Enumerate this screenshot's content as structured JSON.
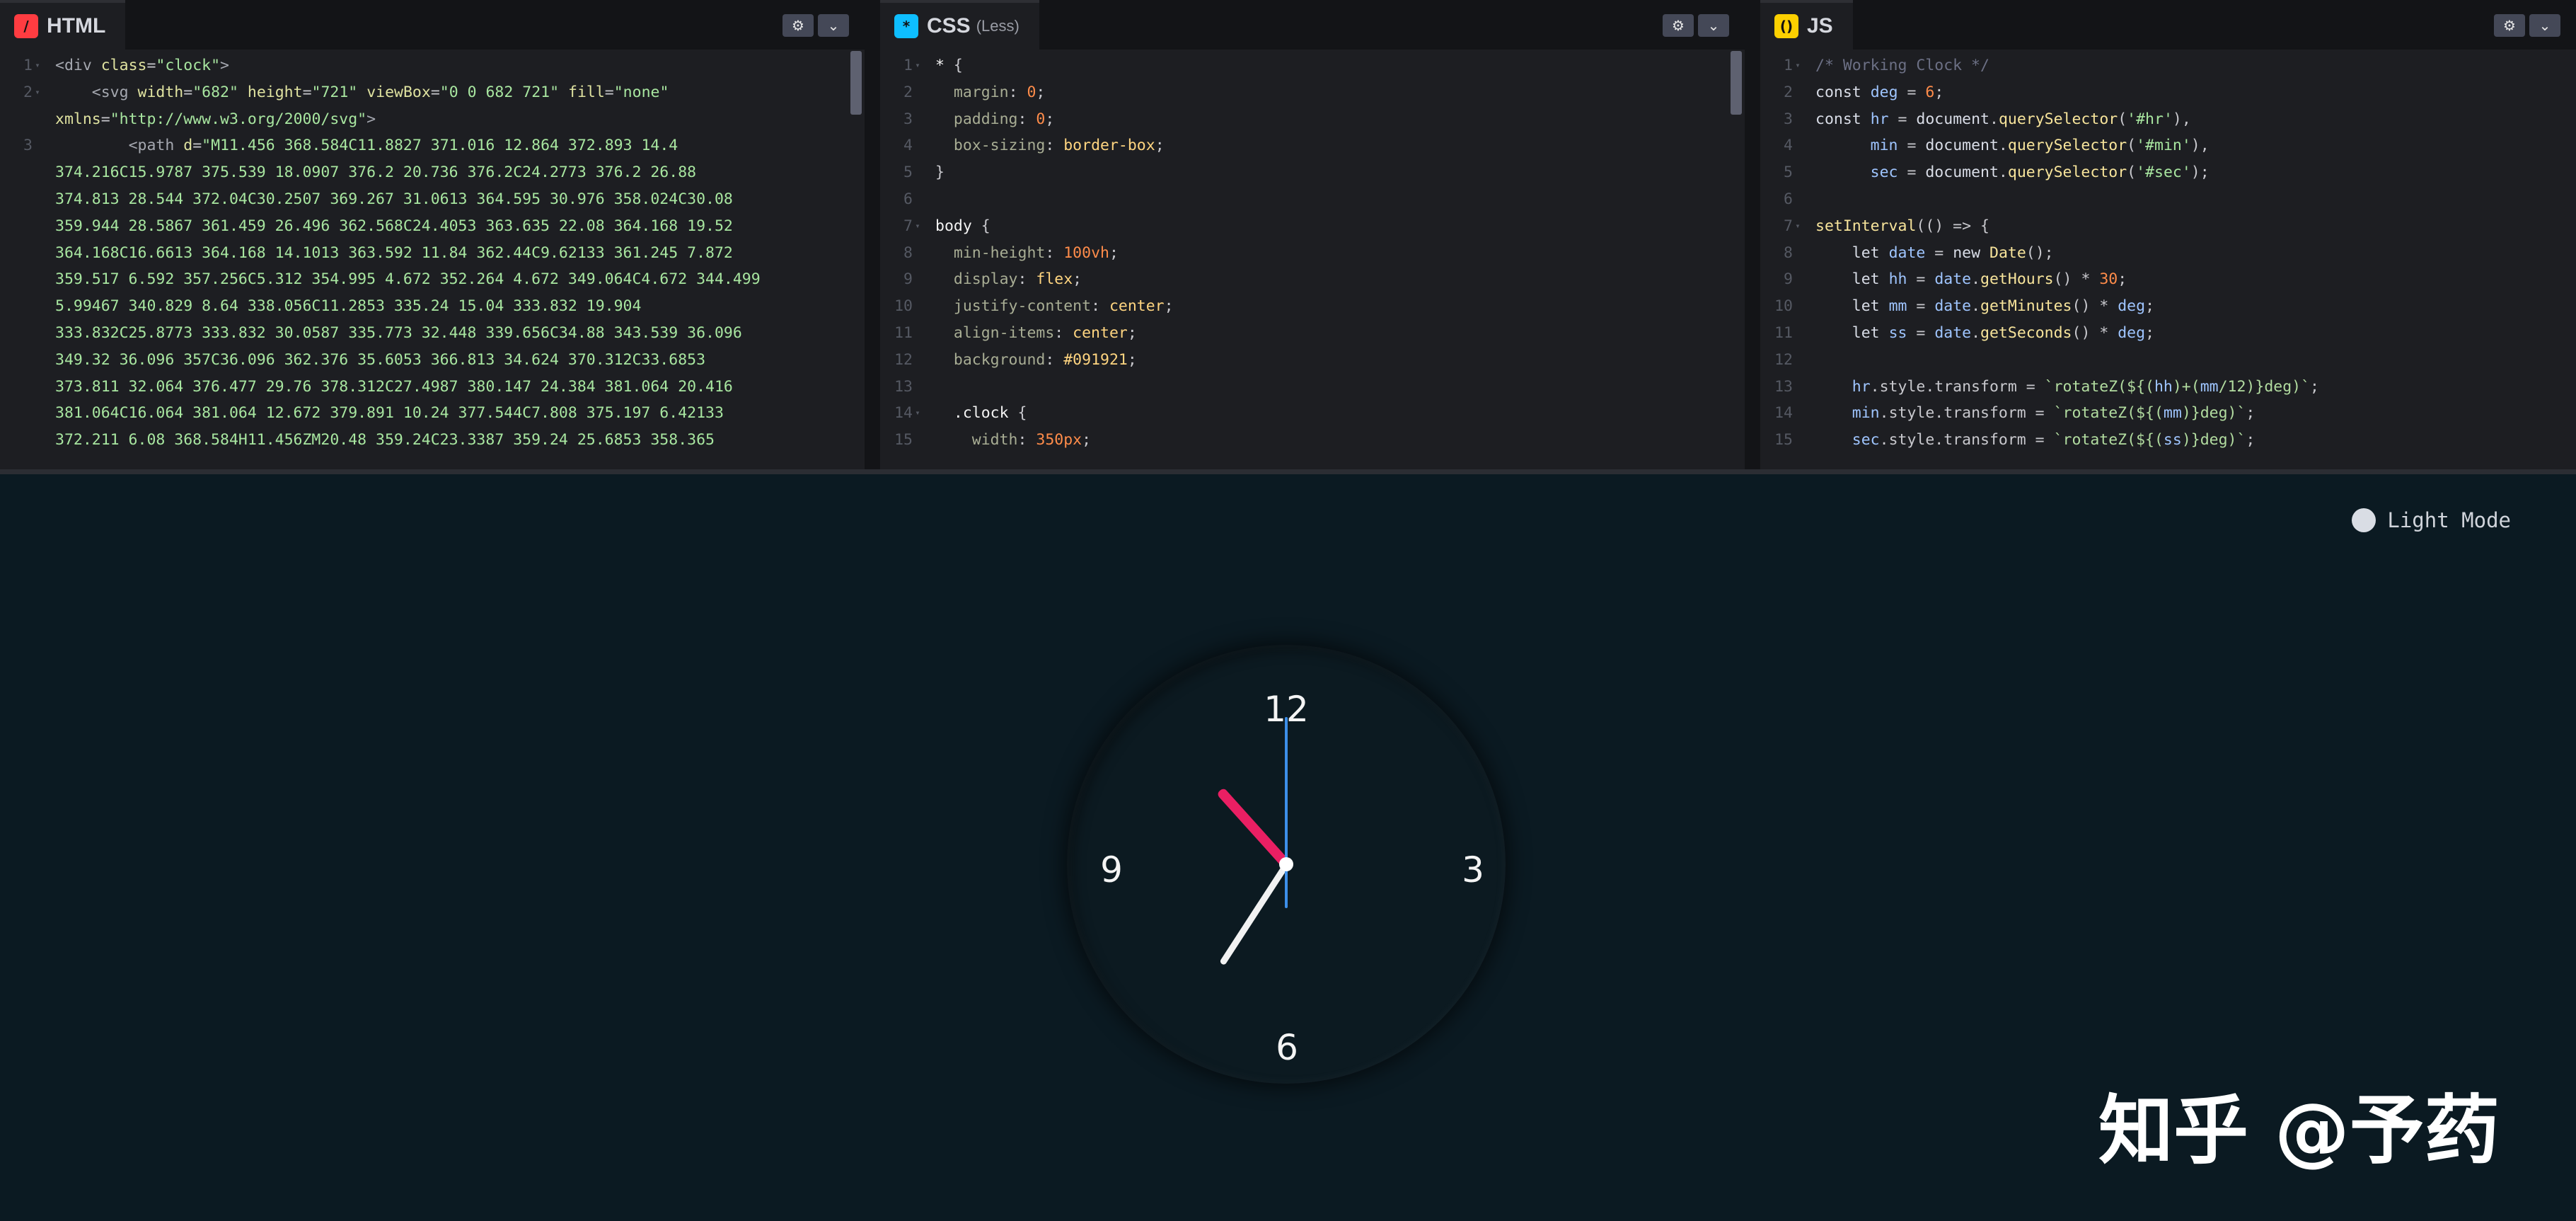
{
  "editor": {
    "panels": [
      {
        "id": "html",
        "title": "HTML",
        "subtitle": "",
        "icon": "html-icon",
        "icon_glyph": "/",
        "icon_color": "#ff3c41",
        "lines": [
          {
            "n": "1",
            "fold": "▾",
            "html": "<span class=\"c-tag\">&lt;div</span> <span class=\"c-attr\">class</span>=<span class=\"c-str\">\"clock\"</span><span class=\"c-tag\">&gt;</span>"
          },
          {
            "n": "2",
            "fold": "▾",
            "html": "    <span class=\"c-tag\">&lt;svg</span> <span class=\"c-attr\">width</span>=<span class=\"c-str\">\"682\"</span> <span class=\"c-attr\">height</span>=<span class=\"c-str\">\"721\"</span> <span class=\"c-attr\">viewBox</span>=<span class=\"c-str\">\"0 0 682 721\"</span> <span class=\"c-attr\">fill</span>=<span class=\"c-str\">\"none\"</span>\n<span class=\"c-attr\">xmlns</span>=<span class=\"c-str\">\"http://www.w3.org/2000/svg\"</span><span class=\"c-tag\">&gt;</span>"
          },
          {
            "n": "3",
            "fold": "",
            "html": "        <span class=\"c-tag\">&lt;path</span> <span class=\"c-attr\">d</span>=<span class=\"c-str\">\"M11.456 368.584C11.8827 371.016 12.864 372.893 14.4\n374.216C15.9787 375.539 18.0907 376.2 20.736 376.2C24.2773 376.2 26.88\n374.813 28.544 372.04C30.2507 369.267 31.0613 364.595 30.976 358.024C30.08\n359.944 28.5867 361.459 26.496 362.568C24.4053 363.635 22.08 364.168 19.52\n364.168C16.6613 364.168 14.1013 363.592 11.84 362.44C9.62133 361.245 7.872\n359.517 6.592 357.256C5.312 354.995 4.672 352.264 4.672 349.064C4.672 344.499\n5.99467 340.829 8.64 338.056C11.2853 335.24 15.04 333.832 19.904\n333.832C25.8773 333.832 30.0587 335.773 32.448 339.656C34.88 343.539 36.096\n349.32 36.096 357C36.096 362.376 35.6053 366.813 34.624 370.312C33.6853\n373.811 32.064 376.477 29.76 378.312C27.4987 380.147 24.384 381.064 20.416\n381.064C16.064 381.064 12.672 379.891 10.24 377.544C7.808 375.197 6.42133\n372.211 6.08 368.584H11.456ZM20.48 359.24C23.3387 359.24 25.6853 358.365</span>"
          }
        ]
      },
      {
        "id": "css",
        "title": "CSS",
        "subtitle": "(Less)",
        "icon": "css-icon",
        "icon_glyph": "*",
        "icon_color": "#0ebeff",
        "lines": [
          {
            "n": "1",
            "fold": "▾",
            "html": "<span class=\"c-sel\">*</span> {"
          },
          {
            "n": "2",
            "fold": "",
            "html": "  <span class=\"c-prop\">margin</span>: <span class=\"c-num\">0</span>;"
          },
          {
            "n": "3",
            "fold": "",
            "html": "  <span class=\"c-prop\">padding</span>: <span class=\"c-num\">0</span>;"
          },
          {
            "n": "4",
            "fold": "",
            "html": "  <span class=\"c-prop\">box-sizing</span>: <span class=\"c-val\">border-box</span>;"
          },
          {
            "n": "5",
            "fold": "",
            "html": "}"
          },
          {
            "n": "6",
            "fold": "",
            "html": ""
          },
          {
            "n": "7",
            "fold": "▾",
            "html": "<span class=\"c-sel\">body</span> {"
          },
          {
            "n": "8",
            "fold": "",
            "html": "  <span class=\"c-prop\">min-height</span>: <span class=\"c-num\">100vh</span>;"
          },
          {
            "n": "9",
            "fold": "",
            "html": "  <span class=\"c-prop\">display</span>: <span class=\"c-val\">flex</span>;"
          },
          {
            "n": "10",
            "fold": "",
            "html": "  <span class=\"c-prop\">justify-content</span>: <span class=\"c-val\">center</span>;"
          },
          {
            "n": "11",
            "fold": "",
            "html": "  <span class=\"c-prop\">align-items</span>: <span class=\"c-val\">center</span>;"
          },
          {
            "n": "12",
            "fold": "",
            "html": "  <span class=\"c-prop\">background</span>: <span class=\"c-val\">#091921</span>;"
          },
          {
            "n": "13",
            "fold": "",
            "html": ""
          },
          {
            "n": "14",
            "fold": "▾",
            "html": "  <span class=\"c-sel\">.clock</span> {"
          },
          {
            "n": "15",
            "fold": "",
            "html": "    <span class=\"c-prop\">width</span>: <span class=\"c-num\">350px</span>;"
          }
        ]
      },
      {
        "id": "js",
        "title": "JS",
        "subtitle": "",
        "icon": "js-icon",
        "icon_glyph": "()",
        "icon_color": "#fcd000",
        "lines": [
          {
            "n": "1",
            "fold": "▾",
            "html": "<span class=\"c-comment\">/* Working Clock */</span>"
          },
          {
            "n": "2",
            "fold": "",
            "html": "<span class=\"c-kw\">const</span> <span class=\"c-var\">deg</span> = <span class=\"c-num\">6</span>;"
          },
          {
            "n": "3",
            "fold": "",
            "html": "<span class=\"c-kw\">const</span> <span class=\"c-var\">hr</span> = <span class=\"c-kw\">document</span>.<span class=\"c-fn\">querySelector</span>(<span class=\"c-str\">'#hr'</span>),"
          },
          {
            "n": "4",
            "fold": "",
            "html": "      <span class=\"c-var\">min</span> = <span class=\"c-kw\">document</span>.<span class=\"c-fn\">querySelector</span>(<span class=\"c-str\">'#min'</span>),"
          },
          {
            "n": "5",
            "fold": "",
            "html": "      <span class=\"c-var\">sec</span> = <span class=\"c-kw\">document</span>.<span class=\"c-fn\">querySelector</span>(<span class=\"c-str\">'#sec'</span>);"
          },
          {
            "n": "6",
            "fold": "",
            "html": ""
          },
          {
            "n": "7",
            "fold": "▾",
            "html": "<span class=\"c-fn\">setInterval</span>(() =&gt; {"
          },
          {
            "n": "8",
            "fold": "",
            "html": "    <span class=\"c-kw\">let</span> <span class=\"c-var\">date</span> = <span class=\"c-kw\">new</span> <span class=\"c-fn\">Date</span>();"
          },
          {
            "n": "9",
            "fold": "",
            "html": "    <span class=\"c-kw\">let</span> <span class=\"c-var\">hh</span> = <span class=\"c-var\">date</span>.<span class=\"c-fn\">getHours</span>() * <span class=\"c-num\">30</span>;"
          },
          {
            "n": "10",
            "fold": "",
            "html": "    <span class=\"c-kw\">let</span> <span class=\"c-var\">mm</span> = <span class=\"c-var\">date</span>.<span class=\"c-fn\">getMinutes</span>() * <span class=\"c-var\">deg</span>;"
          },
          {
            "n": "11",
            "fold": "",
            "html": "    <span class=\"c-kw\">let</span> <span class=\"c-var\">ss</span> = <span class=\"c-var\">date</span>.<span class=\"c-fn\">getSeconds</span>() * <span class=\"c-var\">deg</span>;"
          },
          {
            "n": "12",
            "fold": "",
            "html": ""
          },
          {
            "n": "13",
            "fold": "",
            "html": "    <span class=\"c-var\">hr</span>.style.transform = <span class=\"c-tmpl\">`rotateZ(${(</span><span class=\"c-var\">hh</span><span class=\"c-tmpl\">)+(</span><span class=\"c-var\">mm</span><span class=\"c-tmpl\">/12)}deg)`</span>;"
          },
          {
            "n": "14",
            "fold": "",
            "html": "    <span class=\"c-var\">min</span>.style.transform = <span class=\"c-tmpl\">`rotateZ(${(</span><span class=\"c-var\">mm</span><span class=\"c-tmpl\">)}deg)`</span>;"
          },
          {
            "n": "15",
            "fold": "",
            "html": "    <span class=\"c-var\">sec</span>.style.transform = <span class=\"c-tmpl\">`rotateZ(${(</span><span class=\"c-var\">ss</span><span class=\"c-tmpl\">)}deg)`</span>;"
          }
        ]
      }
    ]
  },
  "preview": {
    "mode_toggle_label": "Light Mode",
    "clock_numbers": [
      "12",
      "3",
      "6",
      "9"
    ],
    "clock_hands": {
      "hour_deg": -42,
      "minute_deg": 213,
      "second_deg": 0
    },
    "colors": {
      "background": "#0b1a22",
      "hour_hand": "#ea1f63",
      "minute_hand": "#f2f2f2",
      "second_hand": "#3d8fe8"
    }
  },
  "watermark": "知乎 @予药"
}
